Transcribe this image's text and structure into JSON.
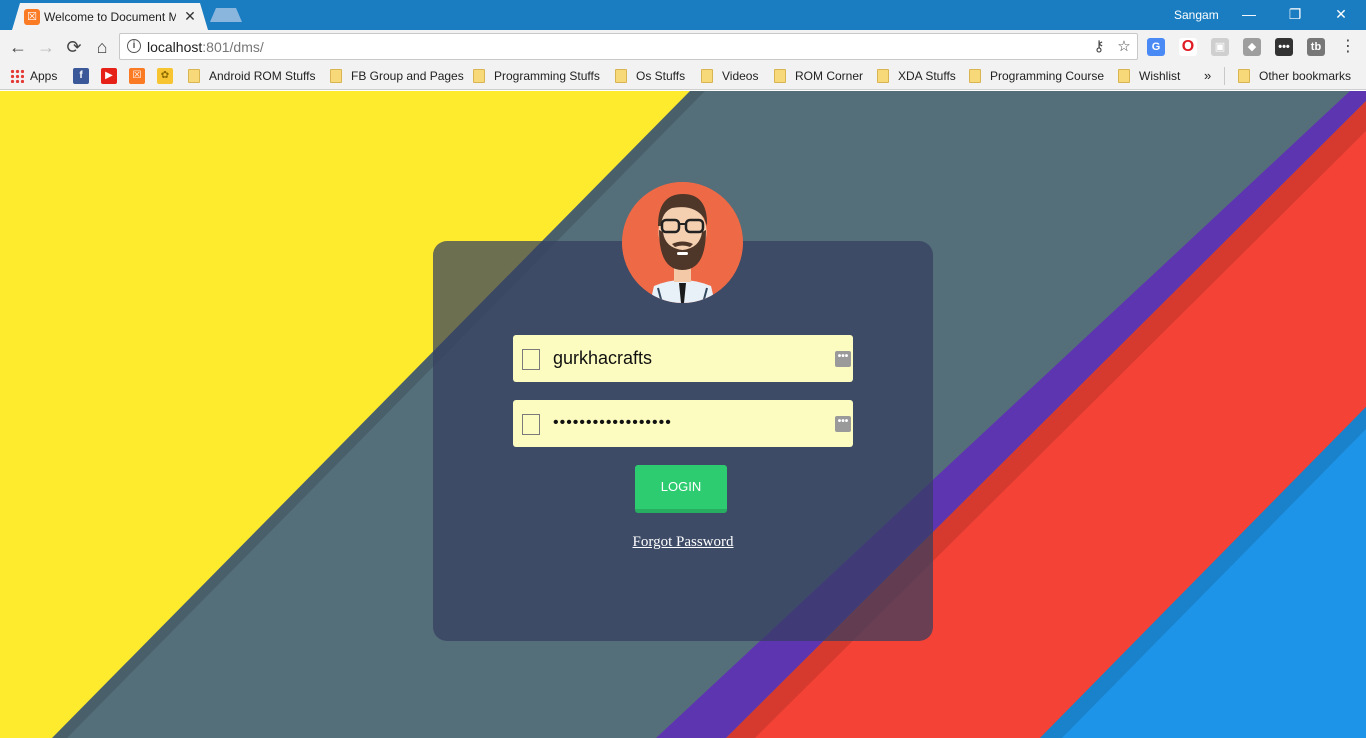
{
  "browser": {
    "tab": {
      "title": "Welcome to Document Management System",
      "favicon": "xampp-icon"
    },
    "profile_name": "Sangam",
    "window_controls": {
      "minimize": "—",
      "restore": "❐",
      "close": "✕"
    },
    "toolbar": {
      "back": "←",
      "forward": "→",
      "reload": "⟳",
      "home": "⌂",
      "url_host": "localhost",
      "url_path": ":801/dms/"
    },
    "bookmarks": {
      "apps_label": "Apps",
      "items": [
        {
          "label": "Android ROM Stuffs"
        },
        {
          "label": "FB Group and Pages"
        },
        {
          "label": "Programming Stuffs"
        },
        {
          "label": "Os Stuffs"
        },
        {
          "label": "Videos"
        },
        {
          "label": "ROM Corner"
        },
        {
          "label": "XDA Stuffs"
        },
        {
          "label": "Programming Course"
        },
        {
          "label": "Wishlist"
        }
      ],
      "overflow": "»",
      "other": "Other bookmarks"
    }
  },
  "login": {
    "username": "gurkhacrafts",
    "password_mask": "••••••••••••••••••",
    "login_label": "LOGIN",
    "forgot_label": "Forgot Password"
  },
  "colors": {
    "yellow": "#ffeb2e",
    "slate": "#546e7a",
    "purple": "#5e35b1",
    "red": "#f44336",
    "blue": "#1e94e8",
    "login_button": "#2ecc71",
    "titlebar": "#1a7dc1"
  }
}
